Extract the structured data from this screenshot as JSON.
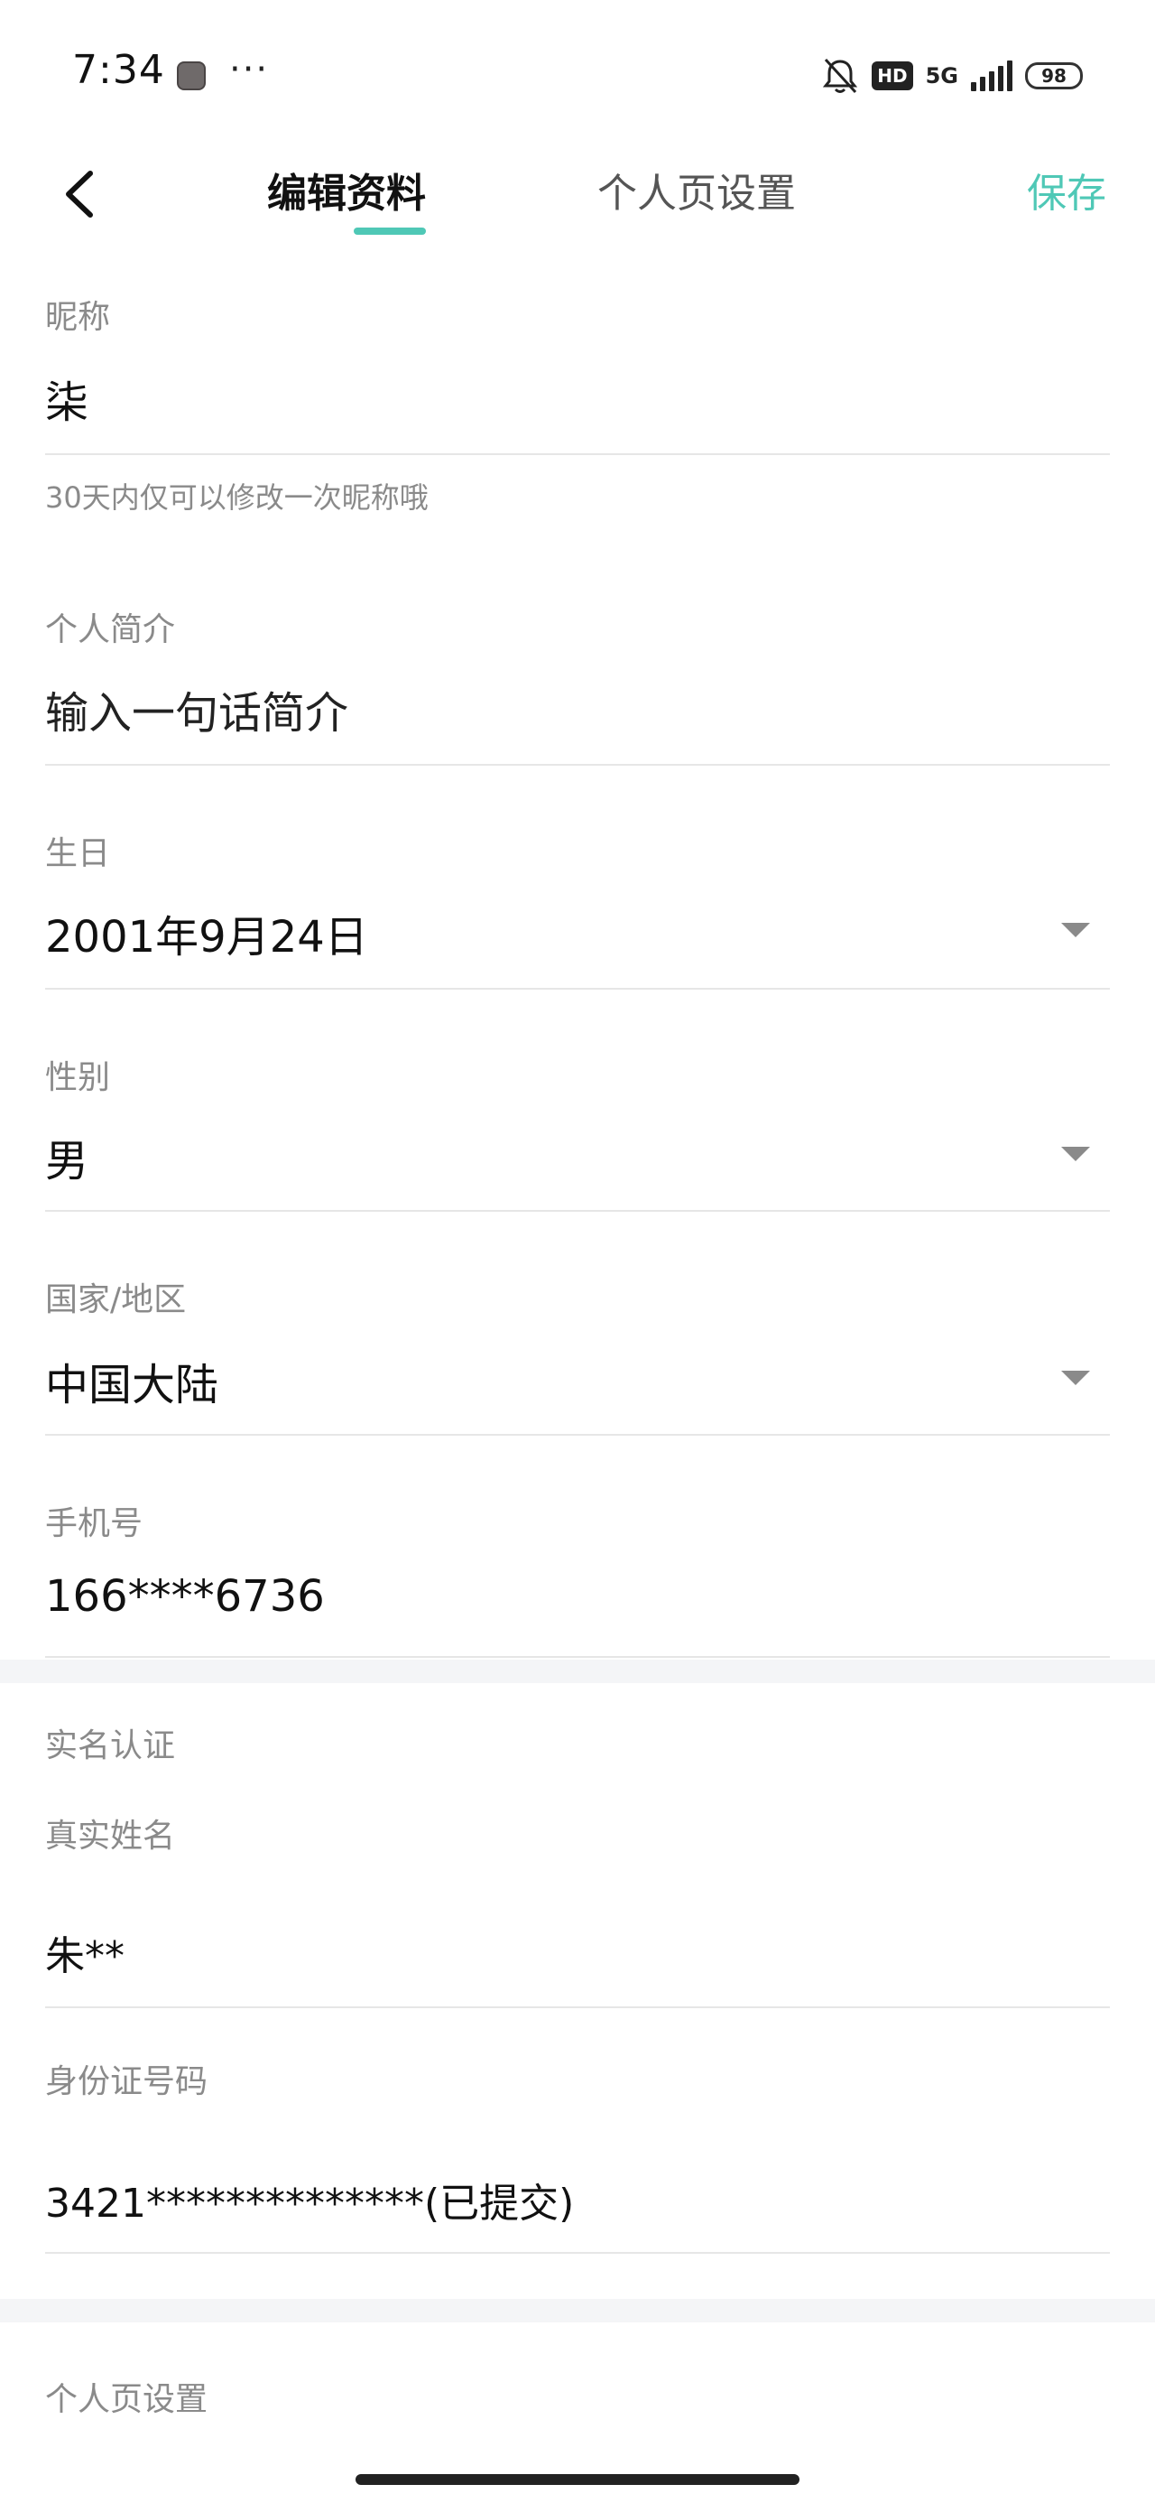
{
  "status_bar": {
    "time": "7:34",
    "dots": "···",
    "hd": "HD",
    "network": "5G",
    "battery": "98",
    "icons": [
      "app-notification-icon",
      "bell-muted-icon",
      "hd-icon",
      "signal-5g-icon",
      "battery-icon"
    ]
  },
  "header": {
    "tabs": [
      {
        "label": "编辑资料",
        "active": true
      },
      {
        "label": "个人页设置",
        "active": false
      }
    ],
    "save_label": "保存",
    "accent_color": "#4fc8b6"
  },
  "nickname": {
    "label": "昵称",
    "value": "柒",
    "hint": "30天内仅可以修改一次昵称哦"
  },
  "bio": {
    "label": "个人简介",
    "placeholder": "输入一句话简介"
  },
  "birthday": {
    "label": "生日",
    "value": "2001年9月24日"
  },
  "gender": {
    "label": "性别",
    "value": "男"
  },
  "region": {
    "label": "国家/地区",
    "value": "中国大陆"
  },
  "phone": {
    "label": "手机号",
    "value": "166****6736"
  },
  "real_name_section": {
    "title": "实名认证",
    "name_label": "真实姓名",
    "name_value": "朱**",
    "id_label": "身份证号码",
    "id_value": "3421**************(已提交)"
  },
  "profile_section": {
    "title": "个人页设置"
  }
}
